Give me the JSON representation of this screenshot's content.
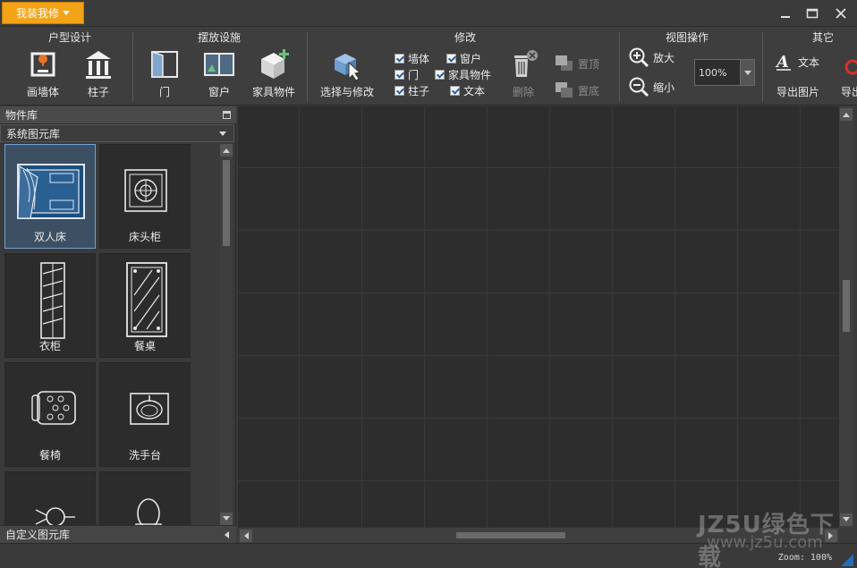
{
  "app_menu": {
    "label": "我装我修"
  },
  "ribbon": {
    "groups": {
      "layout": "户型设计",
      "furnish": "摆放设施",
      "modify": "修改",
      "view": "视图操作",
      "other": "其它"
    },
    "buttons": {
      "draw_wall": "画墙体",
      "pillar": "柱子",
      "door": "门",
      "window": "窗户",
      "furniture": "家具物件",
      "select_modify": "选择与修改",
      "delete": "删除",
      "bring_top": "置顶",
      "send_bottom": "置底",
      "zoom_in": "放大",
      "zoom_out": "缩小",
      "text": "文本",
      "export_image": "导出图片",
      "export_more": "导出"
    },
    "checks": {
      "wall": "墙体",
      "door": "门",
      "pillar": "柱子",
      "window": "窗户",
      "furniture": "家具物件",
      "text": "文本"
    },
    "zoom_value": "100%"
  },
  "library": {
    "title": "物件库",
    "source": "系统图元库",
    "footer": "自定义图元库",
    "items": [
      {
        "label": "双人床",
        "icon": "double-bed-icon",
        "selected": true
      },
      {
        "label": "床头柜",
        "icon": "nightstand-icon",
        "selected": false
      },
      {
        "label": "衣柜",
        "icon": "wardrobe-icon",
        "selected": false
      },
      {
        "label": "餐桌",
        "icon": "dining-table-icon",
        "selected": false
      },
      {
        "label": "餐椅",
        "icon": "dining-chair-icon",
        "selected": false
      },
      {
        "label": "洗手台",
        "icon": "washbasin-icon",
        "selected": false
      },
      {
        "label": "",
        "icon": "lamp-icon",
        "selected": false
      },
      {
        "label": "",
        "icon": "toilet-icon",
        "selected": false
      }
    ]
  },
  "canvas": {
    "zoom_status": "Zoom: 100%"
  },
  "watermark": {
    "line1": "JZ5U绿色下载",
    "line2": "www.jz5u.com"
  },
  "colors": {
    "accent": "#f3a316",
    "selection": "#6fa3d6",
    "canvas_bg": "#2d2d2d",
    "grid": "#3a3a3a"
  }
}
